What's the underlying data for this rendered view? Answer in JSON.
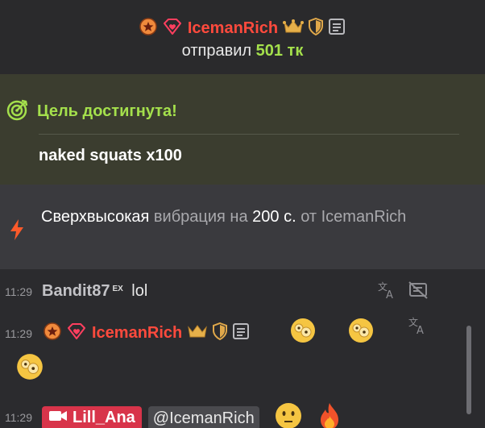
{
  "tip": {
    "username": "IcemanRich",
    "sent_label": "отправил",
    "amount": "501 тк"
  },
  "goal": {
    "title": "Цель достигнута!",
    "text": "naked squats x100"
  },
  "vibration": {
    "w1": "Сверхвысокая",
    "w2": "вибрация на",
    "w3": "200 с.",
    "w4": "от",
    "w5": "IcemanRich"
  },
  "messages": [
    {
      "time": "11:29",
      "username": "Bandit87",
      "badge": "EX",
      "text": "lol"
    },
    {
      "time": "11:29",
      "username": "IcemanRich"
    },
    {
      "time": "11:29",
      "username": "Lill_Ana",
      "mention": "@IcemanRich"
    }
  ],
  "colors": {
    "accent_green": "#a4e04c",
    "user_red": "#ff4a3d",
    "goal_bg": "#3b3d2f",
    "lill_tag": "#d8344a"
  }
}
